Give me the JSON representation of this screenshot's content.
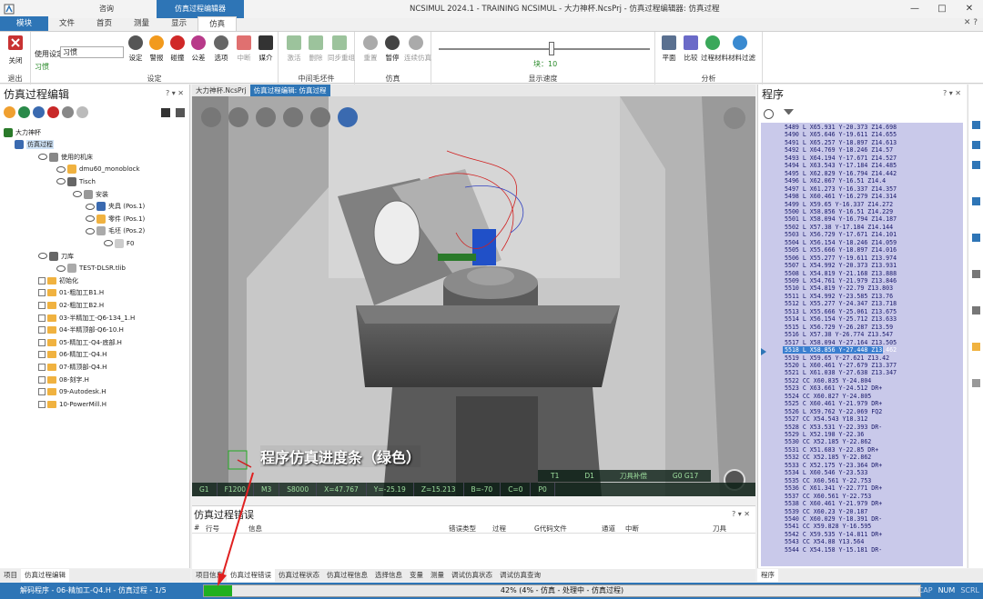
{
  "window": {
    "title": "NCSIMUL 2024.1 - TRAINING NCSIMUL - 大力神杯.NcsPrj - 仿真过程编辑器: 仿真过程",
    "ctx_advisory": "咨询",
    "ctx_sim_editor": "仿真过程编辑器",
    "controls": [
      "—",
      "□",
      "✕"
    ]
  },
  "ribbon_tabs": [
    "模块",
    "文件",
    "首页",
    "测量",
    "显示",
    "仿真"
  ],
  "ribbon_right": "✕ ?",
  "ribbon": {
    "close_label": "关闭",
    "exit_group": "退出",
    "usage_label": "使用设定",
    "usage_value": "习惯",
    "usage_sub": "习惯",
    "settings_group": "设定",
    "buttons_settings": [
      "设定",
      "警报",
      "碰撞",
      "公差",
      "选项",
      "中断",
      "媒介"
    ],
    "brush_group": "中间毛坯件",
    "buttons_brush": [
      "激活",
      "删除",
      "同步重组"
    ],
    "sim_group": "仿真",
    "buttons_sim": [
      "重置",
      "暂停",
      "连续仿真"
    ],
    "speed_group": "显示速度",
    "speed_value": "块：10",
    "analysis_group": "分析",
    "buttons_analysis": [
      "平面",
      "比较",
      "过程材料",
      "材料过滤"
    ]
  },
  "left_panel": {
    "title": "仿真过程编辑",
    "controls": "? ▾ ✕",
    "tree": [
      {
        "label": "大力神杯",
        "level": 0
      },
      {
        "label": "仿真过程",
        "level": 1
      },
      {
        "label": "使用的机床",
        "level": 2
      },
      {
        "label": "dmu60_monoblock",
        "level": 3
      },
      {
        "label": "Tisch",
        "level": 3
      },
      {
        "label": "安装",
        "level": 4
      },
      {
        "label": "夹具 (Pos.1)",
        "level": 5
      },
      {
        "label": "零件 (Pos.1)",
        "level": 5
      },
      {
        "label": "毛坯 (Pos.2)",
        "level": 5
      },
      {
        "label": "F0",
        "level": 6
      },
      {
        "label": "刀库",
        "level": 2
      },
      {
        "label": "TEST-DLSR.tlib",
        "level": 3
      },
      {
        "label": "初始化",
        "level": 2
      },
      {
        "label": "01-粗加工B1.H",
        "level": 2
      },
      {
        "label": "02-粗加工B2.H",
        "level": 2
      },
      {
        "label": "03-半精加工-Q6-134_1.H",
        "level": 2
      },
      {
        "label": "04-半精顶部-Q6-10.H",
        "level": 2
      },
      {
        "label": "05-精加工-Q4-底部.H",
        "level": 2
      },
      {
        "label": "06-精加工-Q4.H",
        "level": 2
      },
      {
        "label": "07-精顶部-Q4.H",
        "level": 2
      },
      {
        "label": "08-刻字.H",
        "level": 2
      },
      {
        "label": "09-Autodesk.H",
        "level": 2
      },
      {
        "label": "10-PowerMill.H",
        "level": 2
      }
    ],
    "bottom_tabs": [
      "项目",
      "仿真过程编辑"
    ]
  },
  "doc_tabs": [
    "大力神杯.NcsPrj",
    "仿真过程编辑: 仿真过程"
  ],
  "viewport": {
    "status_row1": [
      "T1",
      "D1",
      "刀具补偿",
      "G0 G17"
    ],
    "status_row2": [
      "G1",
      "F1200",
      "M3",
      "S8000",
      "X=47.767",
      "Y=-25.19",
      "Z=15.213",
      "B=-70",
      "C=0",
      "P0"
    ],
    "annotation": "程序仿真进度条（绿色）"
  },
  "error_panel": {
    "title": "仿真过程错误",
    "controls": "? ▾ ✕",
    "columns": [
      "#",
      "行号",
      "信息",
      "错误类型",
      "过程",
      "G代码文件",
      "通道",
      "中断",
      "刀具"
    ]
  },
  "mid_bottom_tabs": [
    "项目信息",
    "仿真过程错误",
    "仿真过程状态",
    "仿真过程信息",
    "选择信息",
    "变量",
    "测量",
    "调试仿真状态",
    "调试仿真查询"
  ],
  "right_panel": {
    "title": "程序",
    "controls": "? ▾ ✕",
    "lines": [
      "5489 L X65.931 Y-20.373 Z14.698",
      "5490 L X65.646 Y-19.611 Z14.655",
      "5491 L X65.257 Y-18.897 Z14.613",
      "5492 L X64.769 Y-18.246 Z14.57",
      "5493 L X64.194 Y-17.671 Z14.527",
      "5494 L X63.543 Y-17.184 Z14.485",
      "5495 L X62.829 Y-16.794 Z14.442",
      "5496 L X62.067 Y-16.51 Z14.4",
      "5497 L X61.273 Y-16.337 Z14.357",
      "5498 L X60.461 Y-16.279 Z14.314",
      "5499 L X59.65 Y-16.337 Z14.272",
      "5500 L X58.856 Y-16.51 Z14.229",
      "5501 L X58.094 Y-16.794 Z14.187",
      "5502 L X57.38 Y-17.184 Z14.144",
      "5503 L X56.729 Y-17.671 Z14.101",
      "5504 L X56.154 Y-18.246 Z14.059",
      "5505 L X55.666 Y-18.897 Z14.016",
      "5506 L X55.277 Y-19.611 Z13.974",
      "5507 L X54.992 Y-20.373 Z13.931",
      "5508 L X54.819 Y-21.168 Z13.888",
      "5509 L X54.761 Y-21.979 Z13.846",
      "5510 L X54.819 Y-22.79 Z13.803",
      "5511 L X54.992 Y-23.585 Z13.76",
      "5512 L X55.277 Y-24.347 Z13.718",
      "5513 L X55.666 Y-25.061 Z13.675",
      "5514 L X56.154 Y-25.712 Z13.633",
      "5515 L X56.729 Y-26.287 Z13.59",
      "5516 L X57.38 Y-26.774 Z13.547",
      "5517 L X58.094 Y-27.164 Z13.505",
      "5518 L X58.856 Y-27.448 Z13.462",
      "5519 L X59.65 Y-27.621 Z13.42",
      "5520 L X60.461 Y-27.679 Z13.377",
      "5521 L X61.038 Y-27.638 Z13.347",
      "5522 CC X60.835 Y-24.804",
      "5523 C X63.661 Y-24.512 DR+",
      "5524 CC X60.827 Y-24.805",
      "5525 C X60.461 Y-21.979 DR+",
      "5526 L X59.762 Y-22.069 FQ2",
      "5527 CC X54.543 Y18.312",
      "5528 C X53.531 Y-22.393 DR-",
      "5529 L X52.198 Y-22.36",
      "5530 CC X52.185 Y-22.862",
      "5531 C X51.683 Y-22.85 DR+",
      "5532 CC X52.185 Y-22.862",
      "5533 C X52.175 Y-23.364 DR+",
      "5534 L X60.546 Y-23.533",
      "5535 CC X60.561 Y-22.753",
      "5536 C X61.341 Y-22.771 DR+",
      "5537 CC X60.561 Y-22.753",
      "5538 C X60.461 Y-21.979 DR+",
      "5539 CC X60.23 Y-20.187",
      "5540 C X60.029 Y-18.391 DR-",
      "5541 CC X59.828 Y-16.595",
      "5542 C X59.535 Y-14.811 DR+",
      "5543 CC X54.88 Y13.564",
      "5544 C X54.158 Y-15.181 DR-"
    ],
    "current_index": 29,
    "bottom_tabs": [
      "程序"
    ]
  },
  "statusbar": {
    "message": "解码程序 - 06-精加工-Q4.H - 仿真过程 - 1/5",
    "progress_text": "42% (4% - 仿真 - 处理中 - 仿真过程)",
    "progress_fill": 0.04,
    "indicators": [
      "CAP",
      "NUM",
      "SCRL"
    ]
  },
  "colors": {
    "accent": "#2e75b6",
    "progress": "#20b020",
    "program_bg": "#c9c9ea"
  }
}
